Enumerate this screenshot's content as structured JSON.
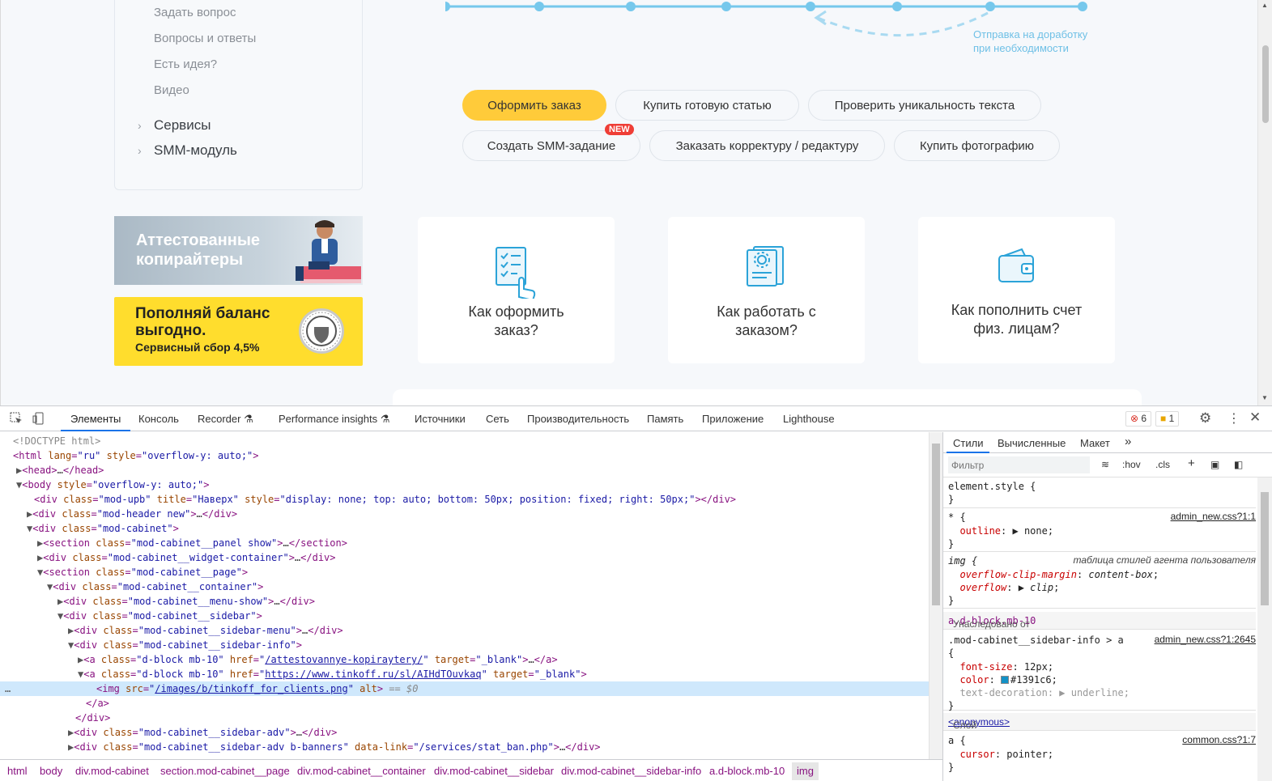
{
  "sidebar": {
    "sub_items": [
      "Задать вопрос",
      "Вопросы и ответы",
      "Есть идея?",
      "Видео"
    ],
    "main_items": [
      "Сервисы",
      "SMM-модуль"
    ]
  },
  "banners": {
    "attested": "Аттестованные копирайтеры",
    "balance_title": "Пополняй баланс выгодно.",
    "balance_fee": "Сервисный сбор 4,5%"
  },
  "timeline": {
    "caption": "Отправка на доработку при необходимости"
  },
  "actions": {
    "order": "Оформить заказ",
    "buy_article": "Купить готовую статью",
    "check_unique": "Проверить уникальность текста",
    "smm_task": "Создать SMM-задание",
    "new_badge": "NEW",
    "proofreading": "Заказать корректуру / редактуру",
    "buy_photo": "Купить фотографию"
  },
  "help_cards": [
    {
      "title": "Как оформить заказ?"
    },
    {
      "title": "Как работать с заказом?"
    },
    {
      "title": "Как пополнить счет физ. лицам?"
    }
  ],
  "devtools": {
    "tabs": [
      "Элементы",
      "Консоль",
      "Recorder",
      "Performance insights",
      "Источники",
      "Сеть",
      "Производительность",
      "Память",
      "Приложение",
      "Lighthouse"
    ],
    "errors": "6",
    "warnings": "1",
    "styles_tabs": [
      "Стили",
      "Вычисленные",
      "Макет"
    ],
    "filter_placeholder": "Фильтр",
    "hov": ":hov",
    "cls": ".cls",
    "breadcrumbs": [
      "html",
      "body",
      "div.mod-cabinet",
      "section.mod-cabinet__page",
      "div.mod-cabinet__container",
      "div.mod-cabinet__sidebar",
      "div.mod-cabinet__sidebar-info",
      "a.d-block.mb-10",
      "img"
    ],
    "inherited_label": "Унаследовано от",
    "inherited_from": "a.d-block.mb-10",
    "layer_label": "Слой",
    "layer_name": "<anonymous>",
    "sources": {
      "admin1": "admin_new.css?1:1",
      "ua": "таблица стилей агента пользователя",
      "admin2645": "admin_new.css?1:2645",
      "common": "common.css?1:7"
    },
    "accent_color": "#1391c6"
  }
}
